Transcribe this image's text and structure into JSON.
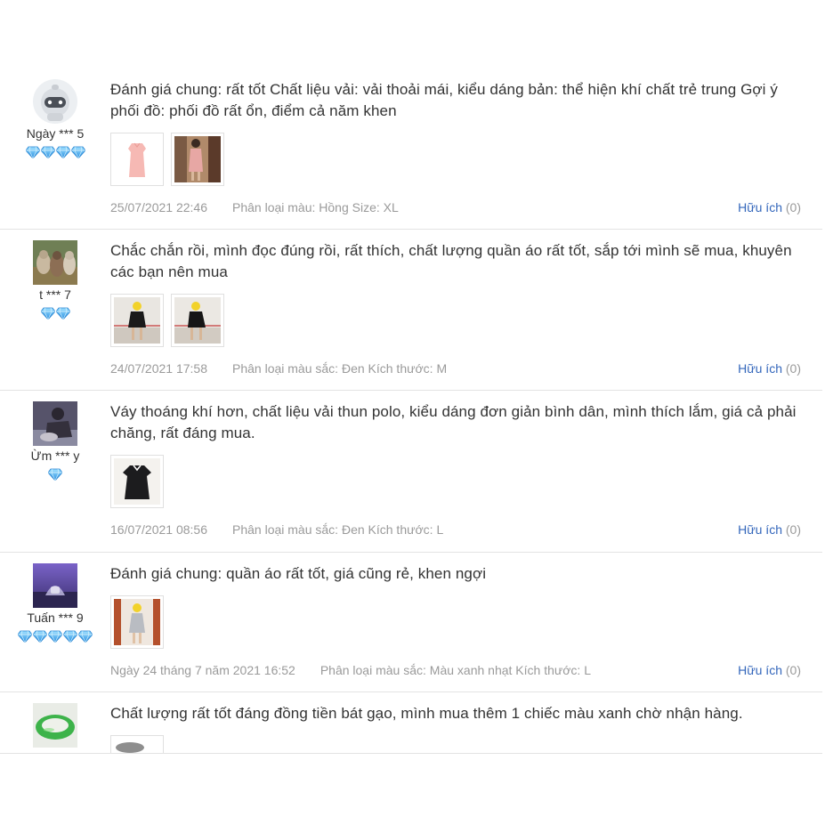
{
  "reviews": [
    {
      "username": "Ngày *** 5",
      "gems": 4,
      "avatar": "robot-avatar",
      "text": "Đánh giá chung: rất tốt Chất liệu vải: vải thoải mái, kiểu dáng bản: thể hiện khí chất trẻ trung Gợi ý phối đồ: phối đồ rất ổn, điểm cả năm khen",
      "images": [
        "pink-dress-photo",
        "pink-dress-worn-photo"
      ],
      "date": "25/07/2021 22:46",
      "variant": "Phân loại màu: Hồng Size: XL",
      "helpful_label": "Hữu ích",
      "helpful_count": "(0)"
    },
    {
      "username": "t *** 7",
      "gems": 2,
      "avatar": "dogs-avatar",
      "text": "Chắc chắn rồi, mình đọc đúng rồi, rất thích, chất lượng quần áo rất tốt, sắp tới mình sẽ mua, khuyên các bạn nên mua",
      "images": [
        "black-dress-worn-photo-1",
        "black-dress-worn-photo-2"
      ],
      "date": "24/07/2021 17:58",
      "variant": "Phân loại màu sắc: Đen Kích thước: M",
      "helpful_label": "Hữu ích",
      "helpful_count": "(0)"
    },
    {
      "username": "Ừm *** y",
      "gems": 1,
      "avatar": "person-avatar",
      "text": "Váy thoáng khí hơn, chất liệu vải thun polo, kiểu dáng đơn giản bình dân, mình thích lắm, giá cả phải chăng, rất đáng mua.",
      "images": [
        "black-dress-flat-photo"
      ],
      "date": "16/07/2021 08:56",
      "variant": "Phân loại màu sắc: Đen Kích thước: L",
      "helpful_label": "Hữu ích",
      "helpful_count": "(0)"
    },
    {
      "username": "Tuấn *** 9",
      "gems": 5,
      "avatar": "purple-avatar",
      "text": "Đánh giá chung: quần áo rất tốt, giá cũng rẻ, khen ngợi",
      "images": [
        "grey-dress-worn-photo"
      ],
      "date": "Ngày 24 tháng 7 năm 2021 16:52",
      "variant": "Phân loại màu sắc: Màu xanh nhạt Kích thước: L",
      "helpful_label": "Hữu ích",
      "helpful_count": "(0)"
    },
    {
      "username": "",
      "gems": 0,
      "avatar": "jade-bracelet-avatar",
      "text": "Chất lượng rất tốt đáng đồng tiền bát gạo, mình mua thêm 1 chiếc màu xanh chờ nhận hàng.",
      "images": [
        "partial-photo"
      ],
      "date": "",
      "variant": "",
      "helpful_label": "",
      "helpful_count": ""
    }
  ],
  "colors": {
    "text": "#333333",
    "meta": "#9a9a9a",
    "link": "#3366bb",
    "divider": "#e3e3e3",
    "gem": "#3fa9f5"
  }
}
